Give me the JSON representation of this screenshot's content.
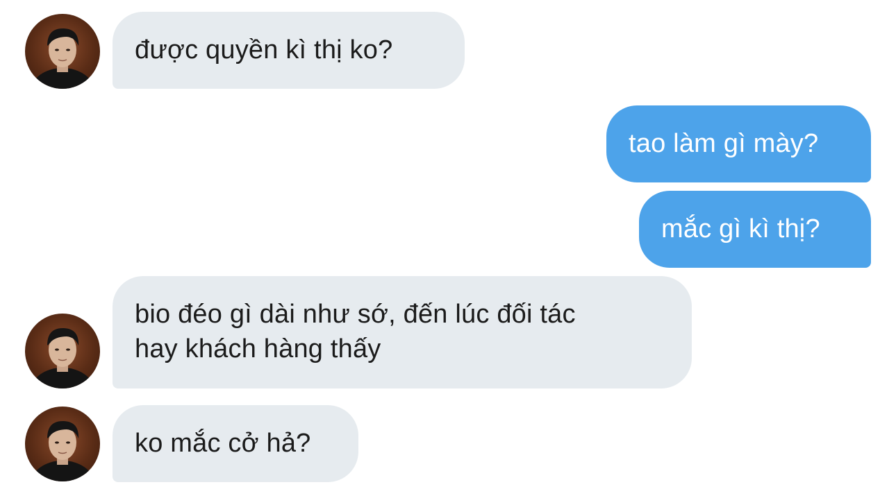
{
  "messages": [
    {
      "direction": "incoming",
      "text": "được quyền kì thị ko?"
    },
    {
      "direction": "outgoing",
      "text": "tao làm gì mày?"
    },
    {
      "direction": "outgoing",
      "text": "mắc gì kì thị?"
    },
    {
      "direction": "incoming",
      "lines": [
        "bio đéo gì dài như sớ, đến lúc đối tác",
        "hay khách hàng thấy"
      ]
    },
    {
      "direction": "incoming",
      "text": "ko mắc cở hả?"
    }
  ],
  "colors": {
    "incoming_bubble": "#e6ebef",
    "outgoing_bubble": "#4da3ea",
    "incoming_text": "#1b1b1b",
    "outgoing_text": "#ffffff"
  },
  "icons": {
    "avatar": "contact-avatar-icon"
  }
}
